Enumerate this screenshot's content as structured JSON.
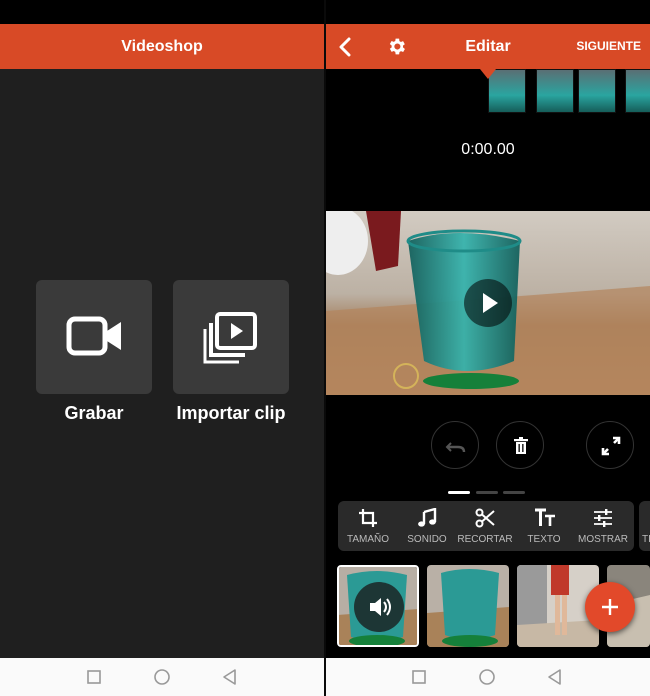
{
  "left_screen": {
    "app_title": "Videoshop",
    "tiles": [
      {
        "label": "Grabar",
        "icon": "video-camera-icon"
      },
      {
        "label": "Importar clip",
        "icon": "import-clip-icon"
      }
    ]
  },
  "right_screen": {
    "header": {
      "title": "Editar",
      "next_label": "SIGUIENTE",
      "back_icon": "chevron-left-icon",
      "settings_icon": "gear-icon"
    },
    "timecode": "0:00.00",
    "preview": {
      "play_icon": "play-icon"
    },
    "controls": {
      "undo_icon": "undo-icon",
      "delete_icon": "trash-icon",
      "fullscreen_icon": "fullscreen-icon"
    },
    "page_indicator": {
      "pages": 3,
      "current": 1
    },
    "tools": [
      {
        "label": "TAMAÑO",
        "icon": "crop-icon"
      },
      {
        "label": "SONIDO",
        "icon": "music-note-icon"
      },
      {
        "label": "RECORTAR",
        "icon": "scissors-icon"
      },
      {
        "label": "TEXTO",
        "icon": "text-icon"
      },
      {
        "label": "MOSTRAR",
        "icon": "sliders-icon"
      }
    ],
    "tools_next_partial": "TI",
    "clips": [
      {
        "name": "clip-1",
        "selected": true,
        "icon": "volume-icon"
      },
      {
        "name": "clip-2",
        "selected": false
      },
      {
        "name": "clip-3",
        "selected": false
      }
    ],
    "add_button_icon": "plus-icon"
  },
  "nav": {
    "icons": [
      "square-icon",
      "circle-icon",
      "triangle-back-icon"
    ]
  },
  "colors": {
    "accent": "#d84a26",
    "dark_bg": "#1f1f1f",
    "tile_bg": "#3a3a3a",
    "fab": "#e2492a"
  }
}
